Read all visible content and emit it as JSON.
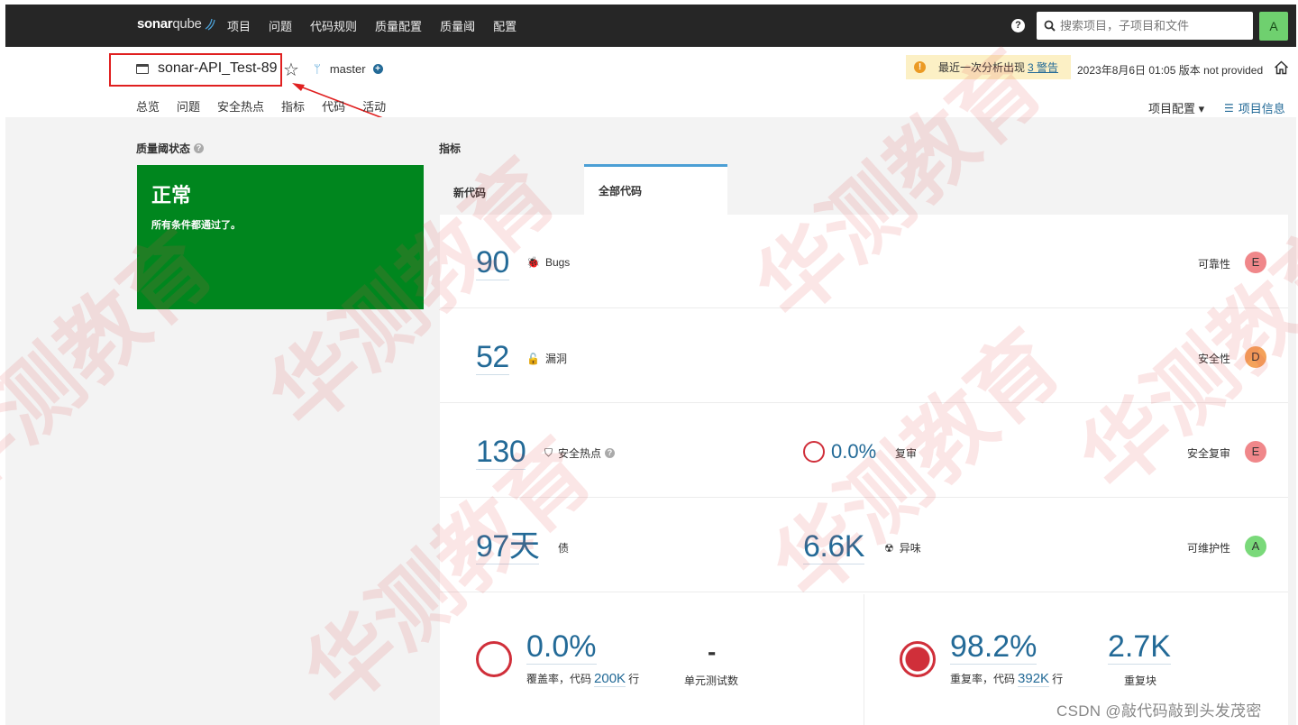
{
  "topnav": {
    "logo_bold": "sonar",
    "logo_rest": "qube",
    "items": [
      "项目",
      "问题",
      "代码规则",
      "质量配置",
      "质量阈",
      "配置"
    ],
    "help_icon": "?",
    "search_placeholder": "搜索项目，子项目和文件",
    "avatar_letter": "A"
  },
  "project": {
    "name": "sonar-API_Test-89",
    "branch": "master",
    "warning_text": "最近一次分析出现",
    "warning_link": "3 警告",
    "analysis_date": "2023年8月6日 01:05",
    "version_text": "版本 not provided",
    "tabs": [
      "总览",
      "问题",
      "安全热点",
      "指标",
      "代码",
      "活动"
    ],
    "config_label": "项目配置 ▾",
    "info_label": "项目信息"
  },
  "quality_gate": {
    "title": "质量阈状态",
    "status": "正常",
    "message": "所有条件都通过了。",
    "status_color": "#00861e"
  },
  "metrics": {
    "title": "指标",
    "tab_new": "新代码",
    "tab_all": "全部代码",
    "bugs": {
      "value": "90",
      "label": "Bugs",
      "rating_label": "可靠性",
      "rating": "E",
      "rating_color": "#f0878a"
    },
    "vulnerabilities": {
      "value": "52",
      "label": "漏洞",
      "rating_label": "安全性",
      "rating": "D",
      "rating_color": "#f4a25a"
    },
    "hotspots": {
      "value": "130",
      "label": "安全热点",
      "review_value": "0.0%",
      "review_label": "复审",
      "rating_label": "安全复审",
      "rating": "E",
      "rating_color": "#f0878a"
    },
    "debt": {
      "value": "97天",
      "label": "债",
      "smells_value": "6.6K",
      "smells_label": "异味",
      "rating_label": "可维护性",
      "rating": "A",
      "rating_color": "#7ad97a"
    },
    "coverage": {
      "value": "0.0%",
      "label_prefix": "覆盖率，代码",
      "lines": "200K",
      "label_suffix": "行",
      "tests_value": "-",
      "tests_label": "单元测试数"
    },
    "duplications": {
      "value": "98.2%",
      "label_prefix": "重复率，代码",
      "lines": "392K",
      "label_suffix": "行",
      "blocks_value": "2.7K",
      "blocks_label": "重复块"
    }
  },
  "watermark": {
    "text": "华测教育",
    "csdn": "CSDN @敲代码敲到头发茂密"
  },
  "colors": {
    "link_blue": "#236a97",
    "accent_blue": "#4b9fd5",
    "nav_dark": "#262626",
    "red_ring": "#d02f3a",
    "annotation_red": "#e02020"
  }
}
